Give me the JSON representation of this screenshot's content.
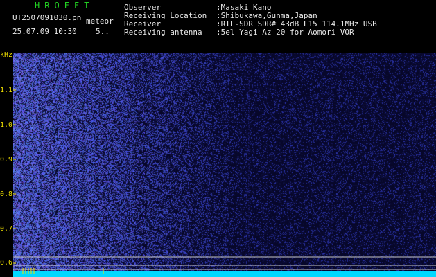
{
  "header": {
    "brand": "HROFFT",
    "filename": "UT2507091030.pn",
    "mode": "meteor",
    "datetime": "25.07.09 10:30",
    "count": "5..",
    "labels": {
      "observer": "Observer",
      "location": "Receiving Location",
      "receiver": "Receiver",
      "antenna": "Receiving antenna"
    },
    "values": {
      "observer": ":Masaki Kano",
      "location": ":Shibukawa,Gunma,Japan",
      "receiver": ":RTL-SDR SDR# 43dB L15 114.1MHz USB",
      "antenna": ":5el Yagi Az 20 for Aomori VOR"
    }
  },
  "spectrogram": {
    "y_unit": "kHz",
    "y_ticks": [
      "1.1",
      "1.0",
      "0.9",
      "0.8",
      "0.7",
      "0.6"
    ],
    "x_ticks": [
      "103",
      "103",
      "103.",
      "103",
      "103",
      "103",
      "103",
      "103",
      "103",
      "1040"
    ],
    "colors": {
      "background": "#07072a",
      "noise": "#3a4cff",
      "baseline": "#00d8ff",
      "marker": "#f0e000"
    }
  }
}
